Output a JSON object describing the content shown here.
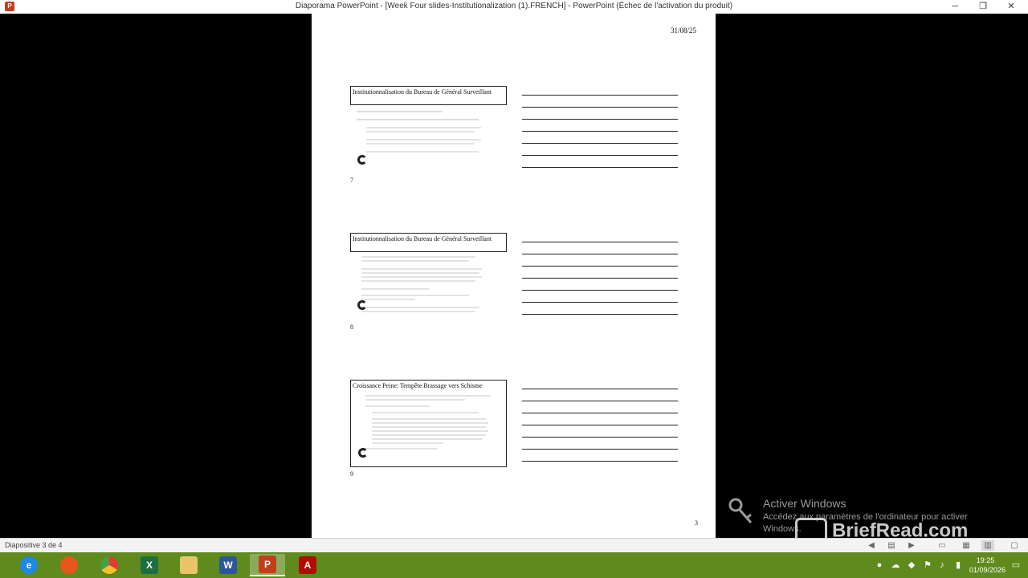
{
  "window": {
    "title": "Diaporama PowerPoint - [Week Four slides-Institutionalization (1).FRENCH] - PowerPoint (Échec de l'activation du produit)",
    "app_icon": "P"
  },
  "page": {
    "date": "31/08/25",
    "page_number": "3",
    "slides": [
      {
        "title": "Institutionnalisation du Bureau de Général Surveillant",
        "number": "7"
      },
      {
        "title": "Institutionnalisation du Bureau de Général Surveillant",
        "number": "8"
      },
      {
        "title": "Croissance Peine: Tempête Brassage vers Schisme",
        "number": "9"
      }
    ]
  },
  "activation": {
    "title": "Activer Windows",
    "subtitle": "Accédez aux paramètres de l'ordinateur pour activer Windows."
  },
  "watermark": "BriefRead.com",
  "statusbar": {
    "slide_info": "Diapositive 3 de 4"
  },
  "taskbar": {
    "apps": [
      {
        "name": "internet-explorer",
        "glyph": "e",
        "color": "#1e88e5"
      },
      {
        "name": "firefox",
        "glyph": "",
        "color": "#e8561d"
      },
      {
        "name": "chrome",
        "glyph": "",
        "color": "#e53935"
      },
      {
        "name": "excel",
        "glyph": "X",
        "color": "#1d6f42"
      },
      {
        "name": "file-explorer",
        "glyph": "",
        "color": "#e9c46a"
      },
      {
        "name": "word",
        "glyph": "W",
        "color": "#2b579a"
      },
      {
        "name": "powerpoint",
        "glyph": "P",
        "color": "#c43e1c"
      },
      {
        "name": "acrobat",
        "glyph": "A",
        "color": "#b30b00"
      }
    ],
    "clock": {
      "time": "19:25",
      "date": "01/09/2026"
    }
  }
}
